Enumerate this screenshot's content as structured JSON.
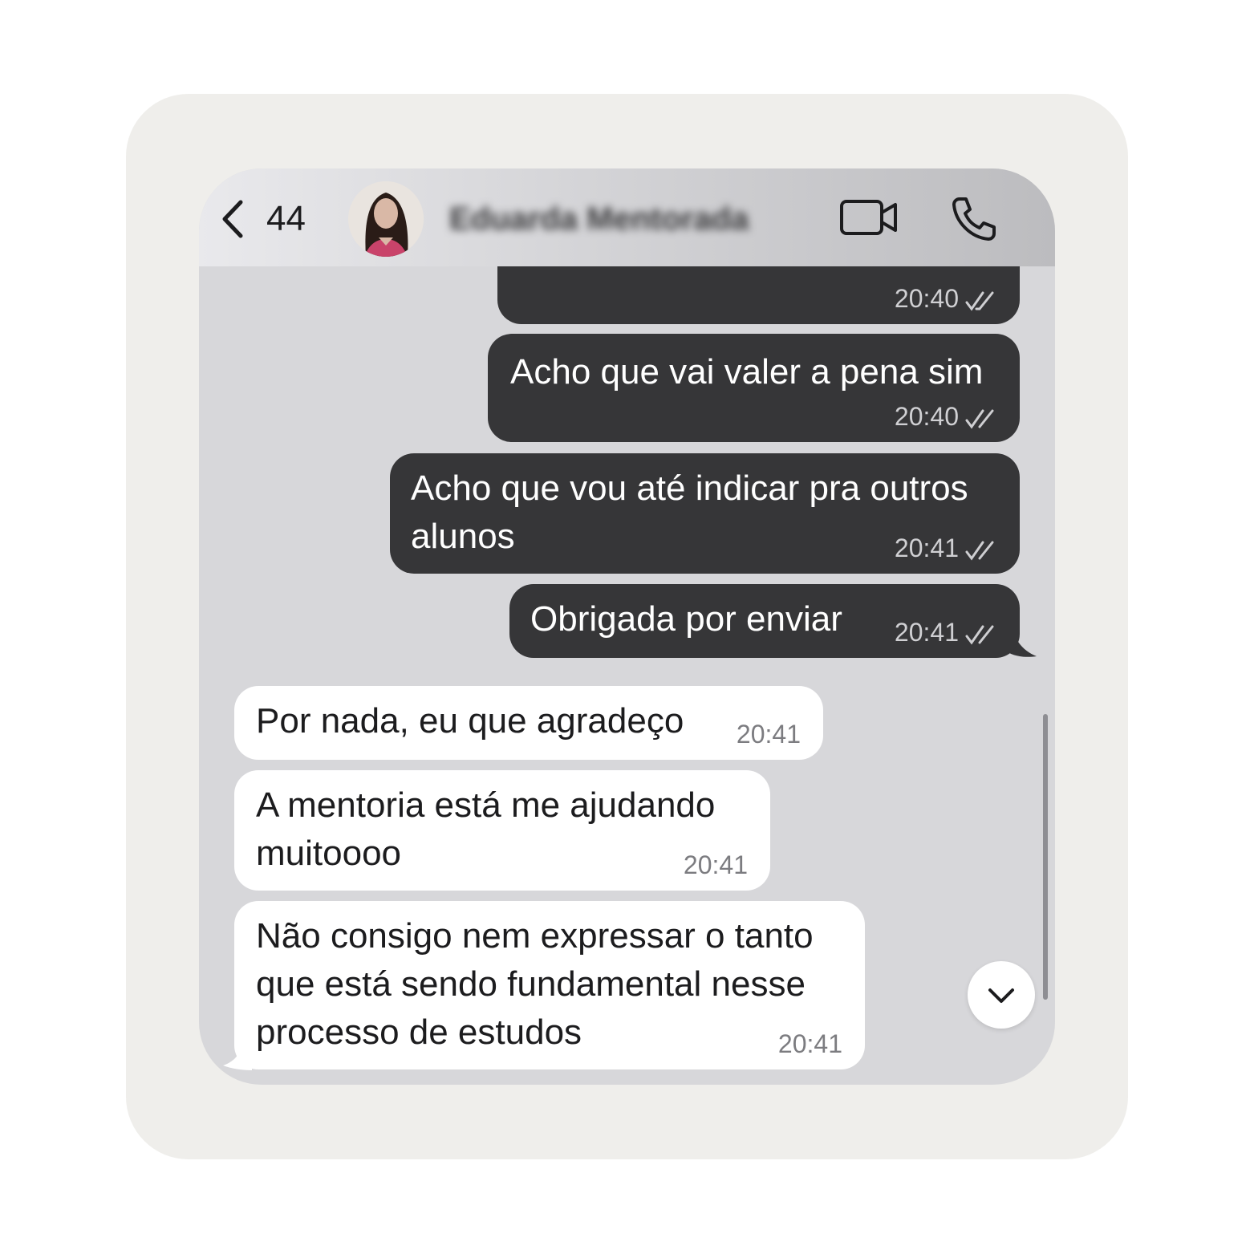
{
  "header": {
    "back_count": "44",
    "contact_name": "Eduarda Mentorada",
    "icons": [
      "chevron-left-icon",
      "video-camera-icon",
      "phone-icon"
    ]
  },
  "messages": [
    {
      "direction": "outgoing",
      "text": "",
      "time": "20:40",
      "status": "read"
    },
    {
      "direction": "outgoing",
      "text": "Acho que vai valer a pena sim",
      "time": "20:40",
      "status": "read"
    },
    {
      "direction": "outgoing",
      "line1": "Acho que vou até indicar pra outros",
      "line2": "alunos",
      "time": "20:41",
      "status": "read"
    },
    {
      "direction": "outgoing",
      "text": "Obrigada por enviar",
      "time": "20:41",
      "status": "read"
    },
    {
      "direction": "incoming",
      "text": "Por nada, eu que agradeço",
      "time": "20:41"
    },
    {
      "direction": "incoming",
      "line1": "A mentoria está me ajudando",
      "line2": "muitoooo",
      "time": "20:41"
    },
    {
      "direction": "incoming",
      "line1": "Não consigo nem expressar o tanto",
      "line2": "que está sendo fundamental nesse",
      "line3": "processo de estudos",
      "time": "20:41"
    }
  ],
  "colors": {
    "outgoing_bubble": "#363638",
    "incoming_bubble": "#ffffff",
    "chat_background": "#d7d7da",
    "card_background": "#efeeeb"
  }
}
